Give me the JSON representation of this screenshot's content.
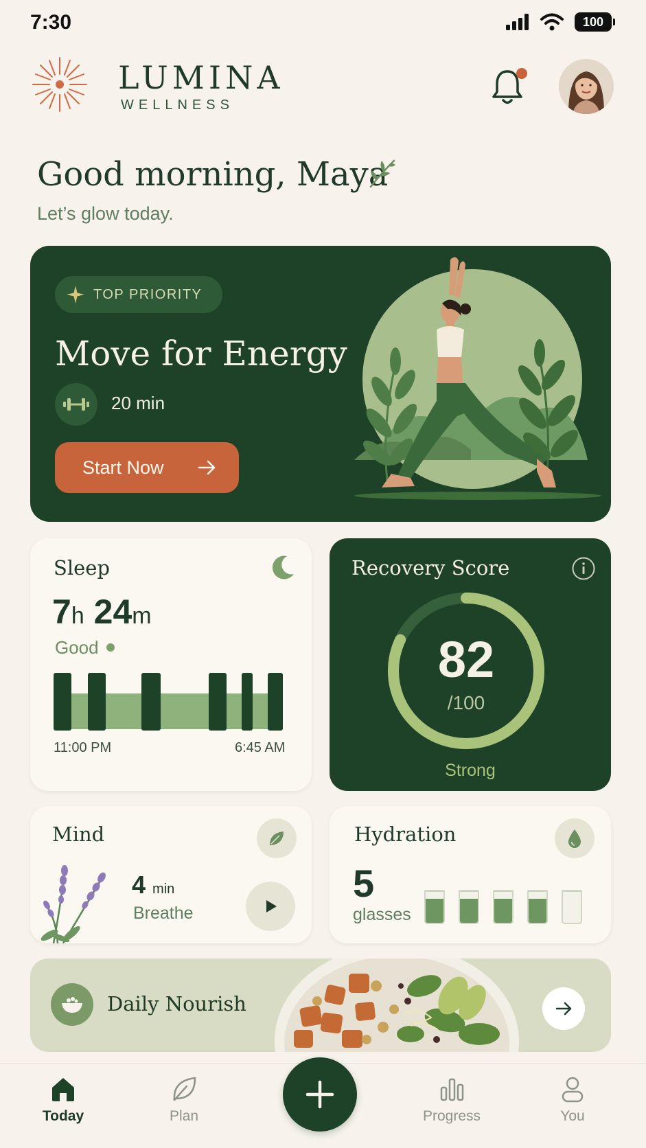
{
  "status_bar": {
    "time": "7:30",
    "battery": "100"
  },
  "header": {
    "brand": "LUMINA",
    "brand_sub": "WELLNESS"
  },
  "greeting": {
    "title": "Good morning, Maya",
    "subtitle": "Let’s glow today."
  },
  "hero": {
    "badge": "TOP PRIORITY",
    "title": "Move for Energy",
    "duration": "20 min",
    "cta": "Start Now"
  },
  "sleep": {
    "title": "Sleep",
    "hours": "7",
    "hours_unit": "h",
    "minutes": "24",
    "minutes_unit": "m",
    "quality": "Good",
    "start": "11:00 PM",
    "end": "6:45 AM"
  },
  "recovery": {
    "title": "Recovery Score",
    "score": "82",
    "max": "/100",
    "label": "Strong",
    "progress": 0.82
  },
  "mind": {
    "title": "Mind",
    "value": "4",
    "unit": "min",
    "label": "Breathe"
  },
  "hydration": {
    "title": "Hydration",
    "value": "5",
    "unit": "glasses",
    "filled": 4,
    "total": 5
  },
  "nourish": {
    "title": "Daily Nourish"
  },
  "tabs": [
    {
      "label": "Today",
      "icon": "home-icon",
      "active": true
    },
    {
      "label": "Plan",
      "icon": "leaf-icon"
    },
    {
      "label": "Progress",
      "icon": "bar-chart-icon"
    },
    {
      "label": "You",
      "icon": "person-icon"
    }
  ],
  "colors": {
    "primary": "#1e4228",
    "accent": "#c8643c",
    "background": "#f7f3ec",
    "sage": "#a9c47a"
  }
}
